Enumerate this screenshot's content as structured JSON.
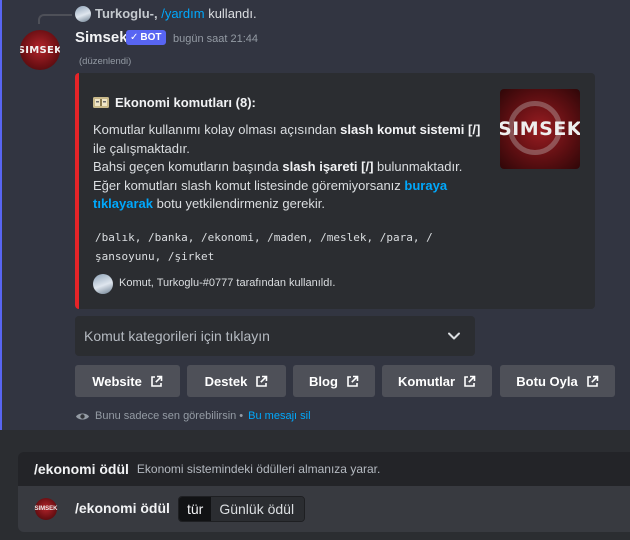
{
  "reply": {
    "user": "Turkoglu-,",
    "command": "/yardım",
    "suffix": "kullandı."
  },
  "message": {
    "avatar_text": "SIMSEK",
    "username": "Simsek",
    "bot_badge": "BOT",
    "timestamp": "bugün saat 21:44",
    "edited": "(düzenlendi)"
  },
  "embed": {
    "accent_color": "#e52428",
    "title": "Ekonomi komutları (8):",
    "body_1": "Komutlar kullanımı kolay olması açısından",
    "body_1_bold": "slash komut sistemi [/]",
    "body_2": "ile çalışmaktadır.",
    "body_3": "Bahsi geçen komutların başında",
    "body_3_bold": "slash işareti [/]",
    "body_3_end": "bulunmaktadır.",
    "body_4": "Eğer komutları slash komut listesinde göremiyorsanız",
    "body_4_link": "buraya tıklayarak",
    "body_4_end": "botu yetkilendirmeniz gerekir.",
    "commands": "/balık, /banka, /ekonomi, /maden, /meslek, /para, /şansoyunu, /şirket",
    "footer": "Komut, Turkoglu-#0777 tarafından kullanıldı.",
    "thumbnail_text": "SIMSEK"
  },
  "select": {
    "placeholder": "Komut kategorileri için tıklayın"
  },
  "buttons": [
    {
      "label": "Website"
    },
    {
      "label": "Destek"
    },
    {
      "label": "Blog"
    },
    {
      "label": "Komutlar"
    },
    {
      "label": "Botu Oyla"
    }
  ],
  "ephemeral": {
    "text": "Bunu sadece sen görebilirsin •",
    "link": "Bu mesajı sil"
  },
  "autocomplete": {
    "command": "/ekonomi ödül",
    "description": "Ekonomi sistemindeki ödülleri almanıza yarar."
  },
  "input": {
    "avatar_text": "SIMSEK",
    "command": "/ekonomi ödül",
    "option_name": "tür",
    "option_value": "Günlük ödül"
  },
  "colors": {
    "link": "#00a8fc",
    "bot_badge": "#5865f2",
    "button": "#4e5058"
  }
}
